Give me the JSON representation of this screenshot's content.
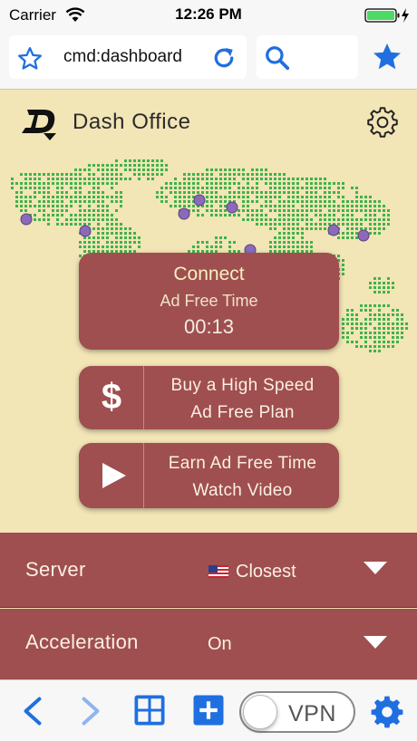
{
  "status_bar": {
    "carrier": "Carrier",
    "time": "12:26 PM"
  },
  "url_bar": {
    "address": "cmd:dashboard"
  },
  "app": {
    "title": "Dash Office"
  },
  "connect": {
    "label": "Connect",
    "subtitle": "Ad Free Time",
    "timer": "00:13"
  },
  "buy_plan": {
    "icon": "$",
    "line1": "Buy a High Speed",
    "line2": "Ad Free Plan"
  },
  "earn_time": {
    "line1": "Earn Ad Free Time",
    "line2": "Watch Video"
  },
  "settings_rows": [
    {
      "label": "Server",
      "value": "Closest"
    },
    {
      "label": "Acceleration",
      "value": "On"
    }
  ],
  "bottom_bar": {
    "vpn_label": "VPN"
  },
  "colors": {
    "accent_blue": "#1f6fe0",
    "panel_red": "#9f4f4f",
    "background_tan": "#f2e5b6",
    "map_green": "#3fb34a",
    "pin_purple": "#8b6bb8"
  },
  "icons": [
    "wifi-icon",
    "battery-icon",
    "bookmark-star-icon",
    "reload-icon",
    "search-icon",
    "favorites-star-icon",
    "app-logo",
    "gear-icon",
    "play-icon",
    "chevron-down-icon",
    "back-arrow-icon",
    "forward-arrow-icon",
    "tabs-grid-icon",
    "new-tab-plus-icon",
    "settings-gear-icon",
    "us-flag-icon"
  ]
}
